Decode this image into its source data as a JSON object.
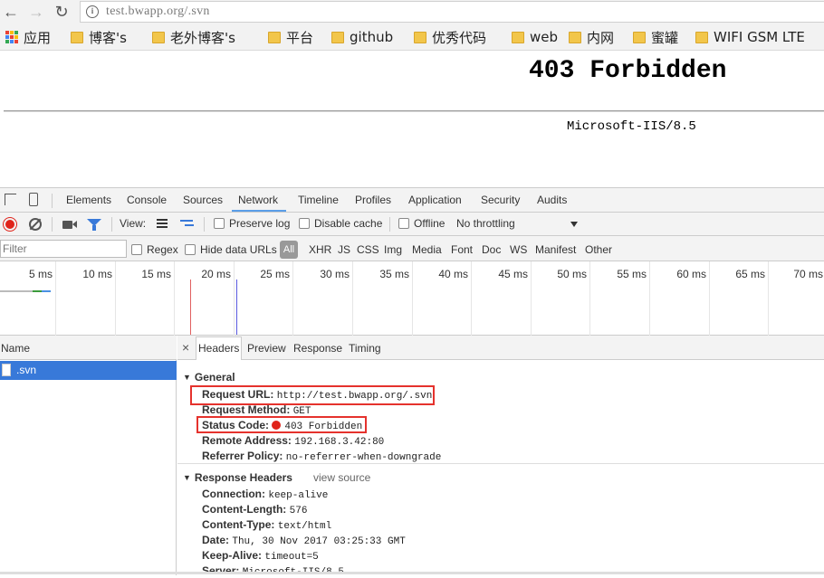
{
  "browser": {
    "url": "test.bwapp.org/.svn",
    "bookmarks": [
      {
        "label": "应用",
        "icon": "apps-grid-icon"
      },
      {
        "label": "博客's",
        "icon": "folder-icon"
      },
      {
        "label": "老外博客's",
        "icon": "folder-icon"
      },
      {
        "label": "平台",
        "icon": "folder-icon"
      },
      {
        "label": "github",
        "icon": "folder-icon"
      },
      {
        "label": "优秀代码",
        "icon": "folder-icon"
      },
      {
        "label": "web",
        "icon": "folder-icon"
      },
      {
        "label": "内网",
        "icon": "folder-icon"
      },
      {
        "label": "蜜罐",
        "icon": "folder-icon"
      },
      {
        "label": "WIFI GSM LTE",
        "icon": "folder-icon"
      }
    ]
  },
  "page": {
    "heading": "403 Forbidden",
    "server_signature": "Microsoft-IIS/8.5"
  },
  "devtools": {
    "tabs": [
      "Elements",
      "Console",
      "Sources",
      "Network",
      "Timeline",
      "Profiles",
      "Application",
      "Security",
      "Audits"
    ],
    "active_tab": "Network",
    "toolbar": {
      "view_label": "View:",
      "preserve_log": "Preserve log",
      "disable_cache": "Disable cache",
      "offline": "Offline",
      "throttling": "No throttling"
    },
    "filterbar": {
      "placeholder": "Filter",
      "regex": "Regex",
      "hide_data_urls": "Hide data URLs",
      "types": [
        "All",
        "XHR",
        "JS",
        "CSS",
        "Img",
        "Media",
        "Font",
        "Doc",
        "WS",
        "Manifest",
        "Other"
      ]
    },
    "timeline_ticks": [
      "5 ms",
      "10 ms",
      "15 ms",
      "20 ms",
      "25 ms",
      "30 ms",
      "35 ms",
      "40 ms",
      "45 ms",
      "50 ms",
      "55 ms",
      "60 ms",
      "65 ms",
      "70 ms"
    ],
    "name_column": {
      "header": "Name",
      "rows": [
        ".svn"
      ]
    },
    "detail_tabs": [
      "Headers",
      "Preview",
      "Response",
      "Timing"
    ],
    "general": {
      "title": "General",
      "rows": [
        {
          "key": "Request URL:",
          "value": "http://test.bwapp.org/.svn"
        },
        {
          "key": "Request Method:",
          "value": "GET"
        },
        {
          "key": "Status Code:",
          "value": "403 Forbidden"
        },
        {
          "key": "Remote Address:",
          "value": "192.168.3.42:80"
        },
        {
          "key": "Referrer Policy:",
          "value": "no-referrer-when-downgrade"
        }
      ]
    },
    "response_headers": {
      "title": "Response Headers",
      "view_source": "view source",
      "rows": [
        {
          "key": "Connection:",
          "value": "keep-alive"
        },
        {
          "key": "Content-Length:",
          "value": "576"
        },
        {
          "key": "Content-Type:",
          "value": "text/html"
        },
        {
          "key": "Date:",
          "value": "Thu, 30 Nov 2017 03:25:33 GMT"
        },
        {
          "key": "Keep-Alive:",
          "value": "timeout=5"
        },
        {
          "key": "Server:",
          "value": "Microsoft-IIS/8.5"
        }
      ]
    }
  }
}
